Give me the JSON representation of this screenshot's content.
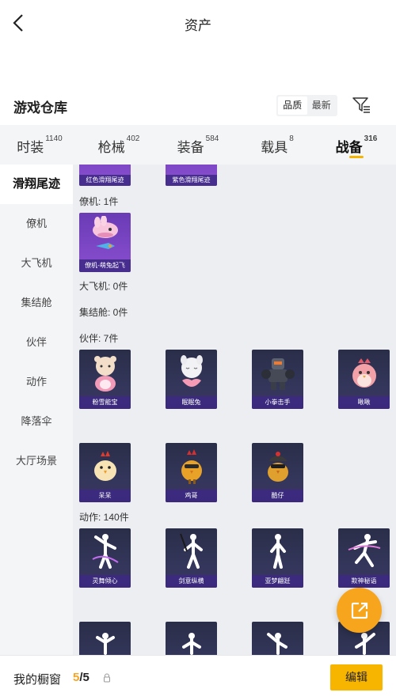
{
  "header": {
    "title": "资产"
  },
  "warehouse": {
    "title": "游戏仓库",
    "sort_options": [
      "品质",
      "最新"
    ],
    "active_sort": "品质"
  },
  "tabs": [
    {
      "label": "时装",
      "count": "1140"
    },
    {
      "label": "枪械",
      "count": "402"
    },
    {
      "label": "装备",
      "count": "584"
    },
    {
      "label": "载具",
      "count": "8"
    },
    {
      "label": "战备",
      "count": "316"
    }
  ],
  "sidebar": {
    "items": [
      "滑翔尾迹",
      "僚机",
      "大飞机",
      "集结舱",
      "伙伴",
      "动作",
      "降落伞",
      "大厅场景"
    ]
  },
  "content": {
    "glide_items": [
      "红色滑翔尾迹",
      "紫色滑翔尾迹"
    ],
    "wingman": {
      "label": "僚机: 1件",
      "items": [
        "僚机-萌兔起飞"
      ]
    },
    "bigplane": {
      "label": "大飞机: 0件"
    },
    "capsule": {
      "label": "集结舱: 0件"
    },
    "partner": {
      "label": "伙伴: 7件",
      "items": [
        "粉雪能宝",
        "眠眠兔",
        "小拳击手",
        "啾啾",
        "呆呆",
        "鸡哥",
        "酷仔"
      ]
    },
    "action": {
      "label": "动作: 140件",
      "items": [
        "灵舞倾心",
        "剑意纵横",
        "亚梦翩跹",
        "欺神秘语"
      ]
    }
  },
  "footer": {
    "showcase_label": "我的橱窗",
    "current": "5",
    "total": "/5",
    "edit_label": "编辑"
  },
  "colors": {
    "accent": "#f7b500",
    "fab": "#f7a51c",
    "tile": "#2a2e48"
  }
}
